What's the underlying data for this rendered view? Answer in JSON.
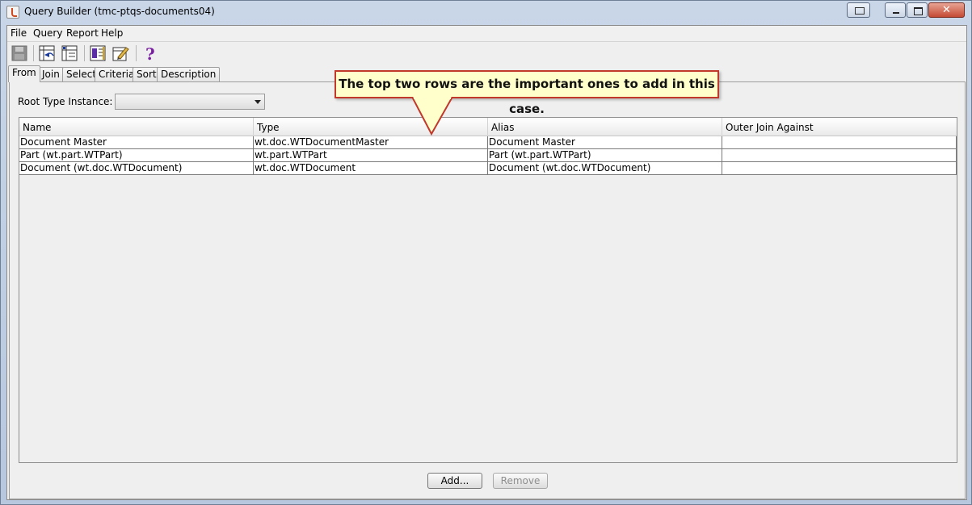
{
  "window": {
    "title": "Query Builder (tmc-ptqs-documents04)",
    "close_glyph": "✕"
  },
  "menu": [
    "File",
    "Query",
    "Report",
    "Help"
  ],
  "toolbar": {
    "icons": [
      "save-icon",
      "join-icon",
      "select-icon",
      "criteria-icon",
      "edit-icon",
      "help-icon"
    ],
    "help_glyph": "?"
  },
  "tabs": [
    "From",
    "Join",
    "Select",
    "Criteria",
    "Sort",
    "Description"
  ],
  "active_tab": "From",
  "root_type": {
    "label": "Root Type Instance:",
    "value": ""
  },
  "table": {
    "columns": [
      "Name",
      "Type",
      "Alias",
      "Outer Join Against"
    ],
    "rows": [
      [
        "Document Master",
        "wt.doc.WTDocumentMaster",
        "Document Master",
        ""
      ],
      [
        "Part (wt.part.WTPart)",
        "wt.part.WTPart",
        "Part (wt.part.WTPart)",
        ""
      ],
      [
        "Document (wt.doc.WTDocument)",
        "wt.doc.WTDocument",
        "Document (wt.doc.WTDocument)",
        ""
      ]
    ]
  },
  "buttons": {
    "add": "Add...",
    "remove": "Remove"
  },
  "callout": {
    "text": "The top two rows are the important ones to add in this case."
  },
  "colors": {
    "callout_bg": "#ffffcc",
    "callout_border": "#c0392b",
    "help_icon": "#7b1fa2"
  }
}
